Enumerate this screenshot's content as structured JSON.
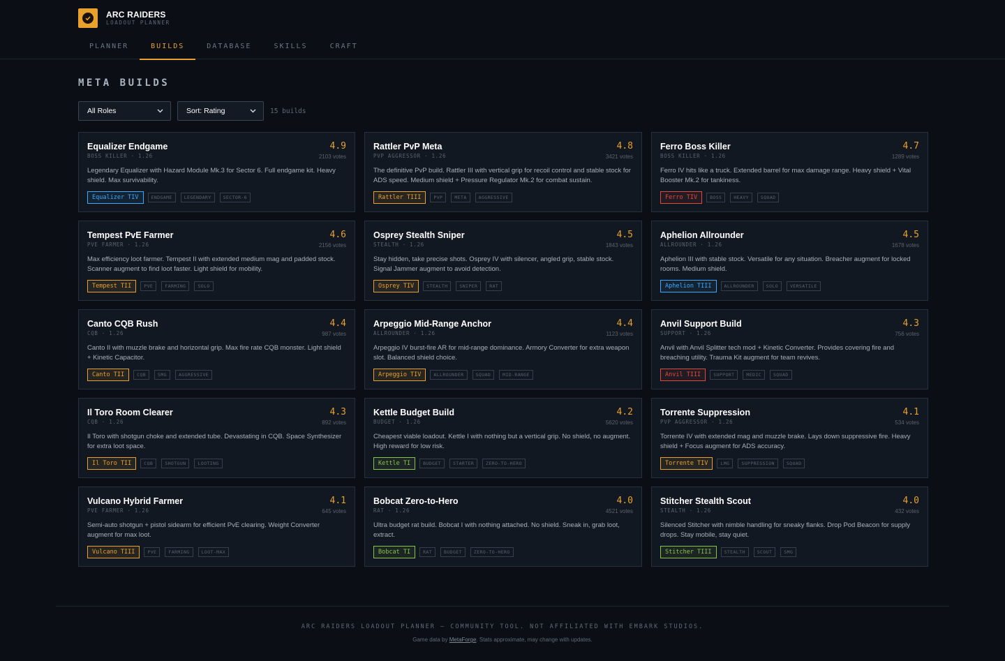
{
  "brand": {
    "title": "ARC RAIDERS",
    "subtitle": "LOADOUT PLANNER"
  },
  "nav": [
    {
      "label": "PLANNER",
      "active": false
    },
    {
      "label": "BUILDS",
      "active": true
    },
    {
      "label": "DATABASE",
      "active": false
    },
    {
      "label": "SKILLS",
      "active": false
    },
    {
      "label": "CRAFT",
      "active": false
    }
  ],
  "page": {
    "title": "META BUILDS"
  },
  "filters": {
    "role": {
      "value": "All Roles"
    },
    "sort": {
      "value": "Sort: Rating"
    },
    "count": "15 builds"
  },
  "colors": {
    "accent": "#e8a12c",
    "tier_blue": "#3aa8ff",
    "tier_gold": "#e8a12c",
    "tier_red": "#e2483f",
    "tier_green": "#8bc34a"
  },
  "builds": [
    {
      "name": "Equalizer Endgame",
      "meta": "BOSS KILLER · 1.26",
      "rating": "4.9",
      "votes": "2103 votes",
      "desc": "Legendary Equalizer with Hazard Module Mk.3 for Sector 6. Full endgame kit. Heavy shield. Max survivability.",
      "weapon": "Equalizer TIV",
      "weapon_color": "blue",
      "tags": [
        "ENDGAME",
        "LEGENDARY",
        "SECTOR-6"
      ]
    },
    {
      "name": "Rattler PvP Meta",
      "meta": "PVP AGGRESSOR · 1.26",
      "rating": "4.8",
      "votes": "3421 votes",
      "desc": "The definitive PvP build. Rattler III with vertical grip for recoil control and stable stock for ADS speed. Medium shield + Pressure Regulator Mk.2 for combat sustain.",
      "weapon": "Rattler TIII",
      "weapon_color": "gold",
      "tags": [
        "PVP",
        "META",
        "AGGRESSIVE"
      ]
    },
    {
      "name": "Ferro Boss Killer",
      "meta": "BOSS KILLER · 1.26",
      "rating": "4.7",
      "votes": "1289 votes",
      "desc": "Ferro IV hits like a truck. Extended barrel for max damage range. Heavy shield + Vital Booster Mk.2 for tankiness.",
      "weapon": "Ferro TIV",
      "weapon_color": "red",
      "tags": [
        "BOSS",
        "HEAVY",
        "SQUAD"
      ]
    },
    {
      "name": "Tempest PvE Farmer",
      "meta": "PVE FARMER · 1.26",
      "rating": "4.6",
      "votes": "2156 votes",
      "desc": "Max efficiency loot farmer. Tempest II with extended medium mag and padded stock. Scanner augment to find loot faster. Light shield for mobility.",
      "weapon": "Tempest TII",
      "weapon_color": "gold",
      "tags": [
        "PVE",
        "FARMING",
        "SOLO"
      ]
    },
    {
      "name": "Osprey Stealth Sniper",
      "meta": "STEALTH · 1.26",
      "rating": "4.5",
      "votes": "1843 votes",
      "desc": "Stay hidden, take precise shots. Osprey IV with silencer, angled grip, stable stock. Signal Jammer augment to avoid detection.",
      "weapon": "Osprey TIV",
      "weapon_color": "gold",
      "tags": [
        "STEALTH",
        "SNIPER",
        "RAT"
      ]
    },
    {
      "name": "Aphelion Allrounder",
      "meta": "ALLROUNDER · 1.26",
      "rating": "4.5",
      "votes": "1678 votes",
      "desc": "Aphelion III with stable stock. Versatile for any situation. Breacher augment for locked rooms. Medium shield.",
      "weapon": "Aphelion TIII",
      "weapon_color": "blue",
      "tags": [
        "ALLROUNDER",
        "SOLO",
        "VERSATILE"
      ]
    },
    {
      "name": "Canto CQB Rush",
      "meta": "CQB · 1.26",
      "rating": "4.4",
      "votes": "987 votes",
      "desc": "Canto II with muzzle brake and horizontal grip. Max fire rate CQB monster. Light shield + Kinetic Capacitor.",
      "weapon": "Canto TII",
      "weapon_color": "gold",
      "tags": [
        "CQB",
        "SMG",
        "AGGRESSIVE"
      ]
    },
    {
      "name": "Arpeggio Mid-Range Anchor",
      "meta": "ALLROUNDER · 1.26",
      "rating": "4.4",
      "votes": "1123 votes",
      "desc": "Arpeggio IV burst-fire AR for mid-range dominance. Armory Converter for extra weapon slot. Balanced shield choice.",
      "weapon": "Arpeggio TIV",
      "weapon_color": "gold",
      "tags": [
        "ALLROUNDER",
        "SQUAD",
        "MID-RANGE"
      ]
    },
    {
      "name": "Anvil Support Build",
      "meta": "SUPPORT · 1.26",
      "rating": "4.3",
      "votes": "756 votes",
      "desc": "Anvil with Anvil Splitter tech mod + Kinetic Converter. Provides covering fire and breaching utility. Trauma Kit augment for team revives.",
      "weapon": "Anvil TIII",
      "weapon_color": "red",
      "tags": [
        "SUPPORT",
        "MEDIC",
        "SQUAD"
      ]
    },
    {
      "name": "Il Toro Room Clearer",
      "meta": "CQB · 1.26",
      "rating": "4.3",
      "votes": "892 votes",
      "desc": "Il Toro with shotgun choke and extended tube. Devastating in CQB. Space Synthesizer for extra loot space.",
      "weapon": "Il Toro TII",
      "weapon_color": "gold",
      "tags": [
        "CQB",
        "SHOTGUN",
        "LOOTING"
      ]
    },
    {
      "name": "Kettle Budget Build",
      "meta": "BUDGET · 1.26",
      "rating": "4.2",
      "votes": "5620 votes",
      "desc": "Cheapest viable loadout. Kettle I with nothing but a vertical grip. No shield, no augment. High reward for low risk.",
      "weapon": "Kettle TI",
      "weapon_color": "green",
      "tags": [
        "BUDGET",
        "STARTER",
        "ZERO-TO-HERO"
      ]
    },
    {
      "name": "Torrente Suppression",
      "meta": "PVP AGGRESSOR · 1.26",
      "rating": "4.1",
      "votes": "534 votes",
      "desc": "Torrente IV with extended mag and muzzle brake. Lays down suppressive fire. Heavy shield + Focus augment for ADS accuracy.",
      "weapon": "Torrente TIV",
      "weapon_color": "gold",
      "tags": [
        "LMG",
        "SUPPRESSION",
        "SQUAD"
      ]
    },
    {
      "name": "Vulcano Hybrid Farmer",
      "meta": "PVE FARMER · 1.26",
      "rating": "4.1",
      "votes": "645 votes",
      "desc": "Semi-auto shotgun + pistol sidearm for efficient PvE clearing. Weight Converter augment for max loot.",
      "weapon": "Vulcano TIII",
      "weapon_color": "gold",
      "tags": [
        "PVE",
        "FARMING",
        "LOOT-MAX"
      ]
    },
    {
      "name": "Bobcat Zero-to-Hero",
      "meta": "RAT · 1.26",
      "rating": "4.0",
      "votes": "4521 votes",
      "desc": "Ultra budget rat build. Bobcat I with nothing attached. No shield. Sneak in, grab loot, extract.",
      "weapon": "Bobcat TI",
      "weapon_color": "green",
      "tags": [
        "RAT",
        "BUDGET",
        "ZERO-TO-HERO"
      ]
    },
    {
      "name": "Stitcher Stealth Scout",
      "meta": "STEALTH · 1.26",
      "rating": "4.0",
      "votes": "432 votes",
      "desc": "Silenced Stitcher with nimble handling for sneaky flanks. Drop Pod Beacon for supply drops. Stay mobile, stay quiet.",
      "weapon": "Stitcher TIII",
      "weapon_color": "green",
      "tags": [
        "STEALTH",
        "SCOUT",
        "SMG"
      ]
    }
  ],
  "footer": {
    "main": "ARC RAIDERS LOADOUT PLANNER — COMMUNITY TOOL. NOT AFFILIATED WITH EMBARK STUDIOS.",
    "prefix": "Game data by ",
    "link": "MetaForge",
    "suffix": ". Stats approximate, may change with updates."
  }
}
